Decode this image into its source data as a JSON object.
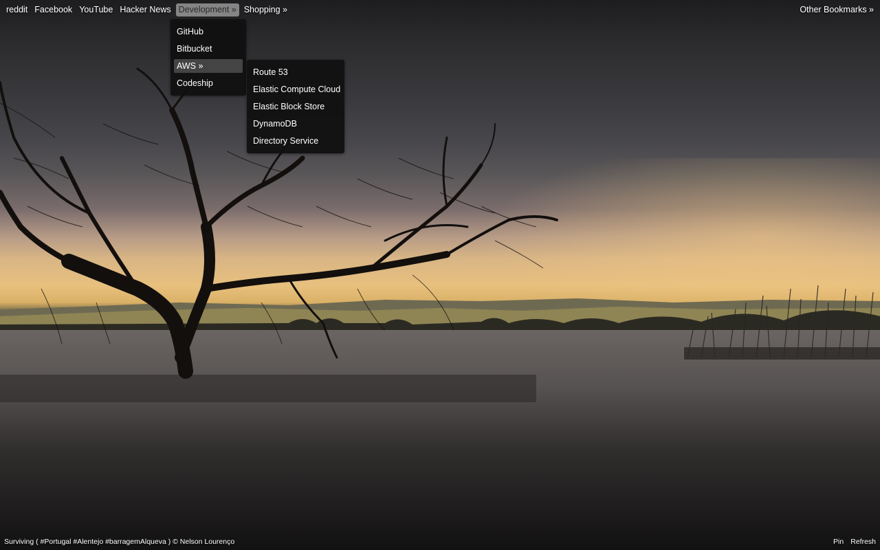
{
  "bookmarks_bar": {
    "items": [
      {
        "label": "reddit"
      },
      {
        "label": "Facebook"
      },
      {
        "label": "YouTube"
      },
      {
        "label": "Hacker News"
      },
      {
        "label": "Development »"
      },
      {
        "label": "Shopping »"
      }
    ],
    "other_bookmarks": "Other Bookmarks »"
  },
  "development_menu": {
    "items": [
      {
        "label": "GitHub"
      },
      {
        "label": "Bitbucket"
      },
      {
        "label": "AWS »"
      },
      {
        "label": "Codeship"
      }
    ]
  },
  "aws_menu": {
    "items": [
      {
        "label": "Route 53"
      },
      {
        "label": "Elastic Compute Cloud"
      },
      {
        "label": "Elastic Block Store"
      },
      {
        "label": "DynamoDB"
      },
      {
        "label": "Directory Service"
      }
    ]
  },
  "footer": {
    "caption": "Surviving ( #Portugal #Alentejo #barragemAlqueva )  © Nelson Lourenço",
    "pin_label": "Pin",
    "refresh_label": "Refresh"
  },
  "colors": {
    "menu_background": "#101010",
    "active_bookmark": "#969696",
    "active_menu_item": "#444444",
    "text": "#ffffff"
  }
}
